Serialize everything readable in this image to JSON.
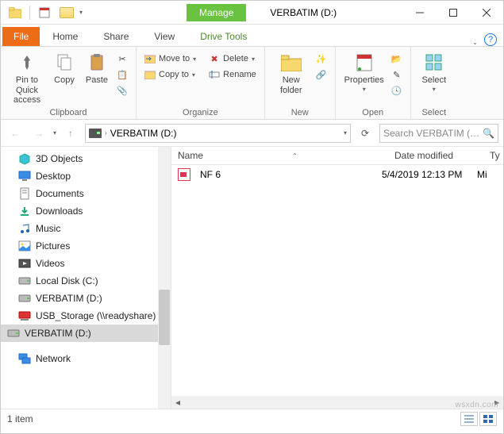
{
  "titlebar": {
    "context_tab": "Manage",
    "window_title": "VERBATIM (D:)"
  },
  "tabs": {
    "file": "File",
    "home": "Home",
    "share": "Share",
    "view": "View",
    "drive_tools": "Drive Tools"
  },
  "ribbon": {
    "clipboard": {
      "label": "Clipboard",
      "pin": "Pin to Quick\naccess",
      "copy": "Copy",
      "paste": "Paste"
    },
    "organize": {
      "label": "Organize",
      "move_to": "Move to",
      "copy_to": "Copy to",
      "delete": "Delete",
      "rename": "Rename"
    },
    "new": {
      "label": "New",
      "new_folder": "New\nfolder"
    },
    "open": {
      "label": "Open",
      "properties": "Properties"
    },
    "select": {
      "label": "Select",
      "select": "Select"
    }
  },
  "address": {
    "path_text": "VERBATIM (D:)",
    "search_placeholder": "Search VERBATIM (…"
  },
  "tree": {
    "items": [
      {
        "label": "3D Objects",
        "icon": "cube",
        "indent": 22
      },
      {
        "label": "Desktop",
        "icon": "desktop",
        "indent": 22
      },
      {
        "label": "Documents",
        "icon": "doc",
        "indent": 22
      },
      {
        "label": "Downloads",
        "icon": "download",
        "indent": 22
      },
      {
        "label": "Music",
        "icon": "music",
        "indent": 22
      },
      {
        "label": "Pictures",
        "icon": "pictures",
        "indent": 22
      },
      {
        "label": "Videos",
        "icon": "videos",
        "indent": 22
      },
      {
        "label": "Local Disk (C:)",
        "icon": "disk",
        "indent": 22
      },
      {
        "label": "VERBATIM (D:)",
        "icon": "disk",
        "indent": 22
      },
      {
        "label": "USB_Storage (\\\\readyshare)",
        "icon": "netdrive",
        "indent": 22
      },
      {
        "label": "VERBATIM (D:)",
        "icon": "disk",
        "indent": 8,
        "selected": true
      },
      {
        "label": "Network",
        "icon": "network",
        "indent": 22
      }
    ]
  },
  "list": {
    "columns": {
      "name": "Name",
      "date": "Date modified",
      "type": "Ty"
    },
    "rows": [
      {
        "name": "NF 6",
        "date": "5/4/2019 12:13 PM",
        "type": "Mi"
      }
    ]
  },
  "status": {
    "count_text": "1 item"
  },
  "watermark": "wsxdn.com"
}
